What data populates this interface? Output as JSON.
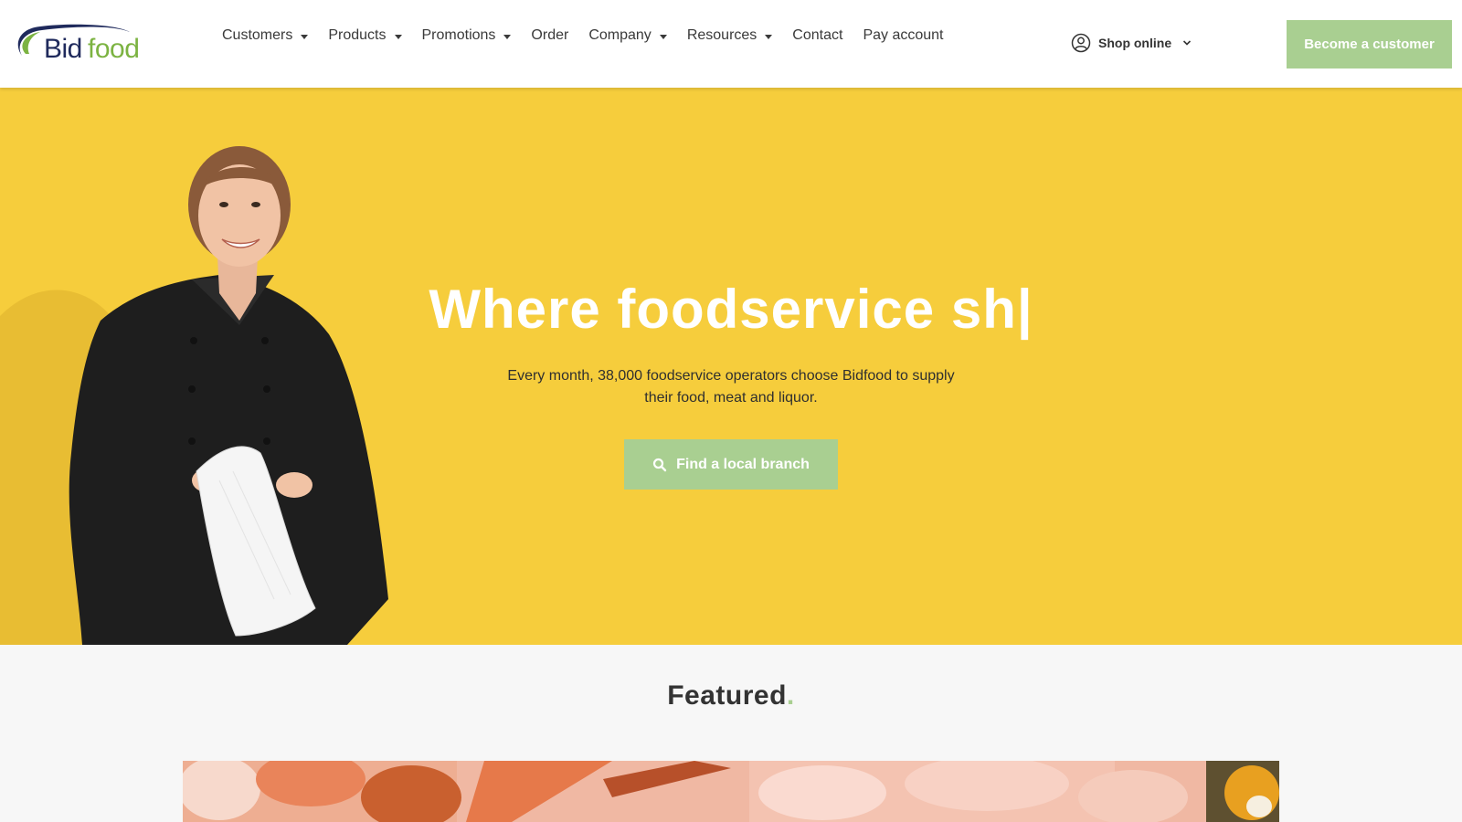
{
  "header": {
    "logo_text": "Bidfood",
    "nav": [
      {
        "label": "Customers",
        "has_dropdown": true
      },
      {
        "label": "Products",
        "has_dropdown": true
      },
      {
        "label": "Promotions",
        "has_dropdown": true
      },
      {
        "label": "Order",
        "has_dropdown": false
      },
      {
        "label": "Company",
        "has_dropdown": true
      },
      {
        "label": "Resources",
        "has_dropdown": true
      },
      {
        "label": "Contact",
        "has_dropdown": false
      },
      {
        "label": "Pay account",
        "has_dropdown": false
      }
    ],
    "shop_online": {
      "label": "Shop online",
      "icon": "user-circle-icon"
    },
    "cta_label": "Become a customer"
  },
  "hero": {
    "title_prefix": "Where ",
    "title_bold": "foodservice",
    "title_suffix": " sh|",
    "subtitle": "Every month, 38,000 foodservice operators choose Bidfood to supply their food, meat and liquor.",
    "button_label": "Find a local branch",
    "button_icon": "search-icon"
  },
  "featured": {
    "title": "Featured",
    "title_dot": "."
  },
  "colors": {
    "brand_green": "#a9cf91",
    "hero_yellow": "#f6cd3c",
    "logo_navy": "#1f2a5c",
    "logo_green": "#7cb342"
  }
}
